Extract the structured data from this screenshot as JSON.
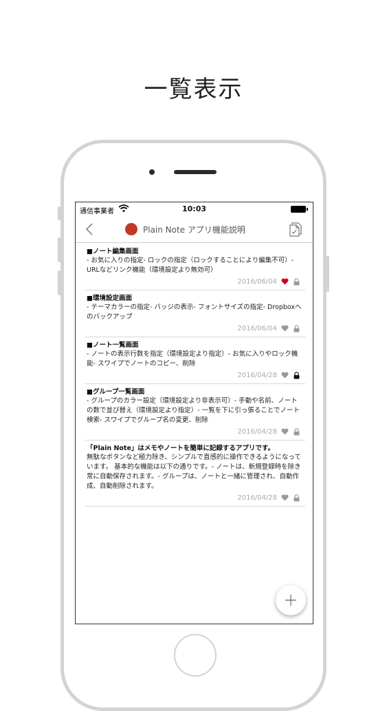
{
  "headline": "一覧表示",
  "status_bar": {
    "carrier": "通信事業者",
    "time": "10:03"
  },
  "nav": {
    "title": "Plain Note アプリ機能説明",
    "theme_color": "#c0392b"
  },
  "notes": [
    {
      "title": "■ノート編集画面",
      "body": "- お気に入りの指定- ロックの指定（ロックすることにより編集不可）- URLなどリンク機能（環境設定より無効可）",
      "date": "2016/06/04",
      "favorite": true,
      "locked": false
    },
    {
      "title": "■環境設定画面",
      "body": "- テーマカラーの指定- バッジの表示- フォントサイズの指定- Dropboxへのバックアップ",
      "date": "2016/06/04",
      "favorite": false,
      "locked": false
    },
    {
      "title": "■ノート一覧画面",
      "body": "- ノートの表示行数を指定（環境設定より指定）- お気に入りやロック機能- スワイプでノートのコピー、削除",
      "date": "2016/04/28",
      "favorite": false,
      "locked": true
    },
    {
      "title": "■グループ一覧画面",
      "body": "- グループのカラー設定（環境設定より非表示可）- 手動や名前、ノートの数で並び替え（環境設定より指定）- 一覧を下に引っ張ることでノート検索- スワイプでグループ名の変更、削除",
      "date": "2016/04/28",
      "favorite": false,
      "locked": false
    },
    {
      "title": "「Plain Note」はメモやノートを簡単に記録するアプリです。",
      "body": "無駄なボタンなど極力除き、シンプルで直感的に操作できるようになっています。 基本的な機能は以下の通りです。- ノートは、新規登録時を除き常に自動保存されます。- グループは、ノートと一緒に管理され、自動作成、自動削除されます。",
      "date": "2016/04/28",
      "favorite": false,
      "locked": false
    }
  ],
  "colors": {
    "favorite_active": "#d0021b",
    "icon_inactive": "#9a9a9a",
    "locked_active": "#111111"
  }
}
